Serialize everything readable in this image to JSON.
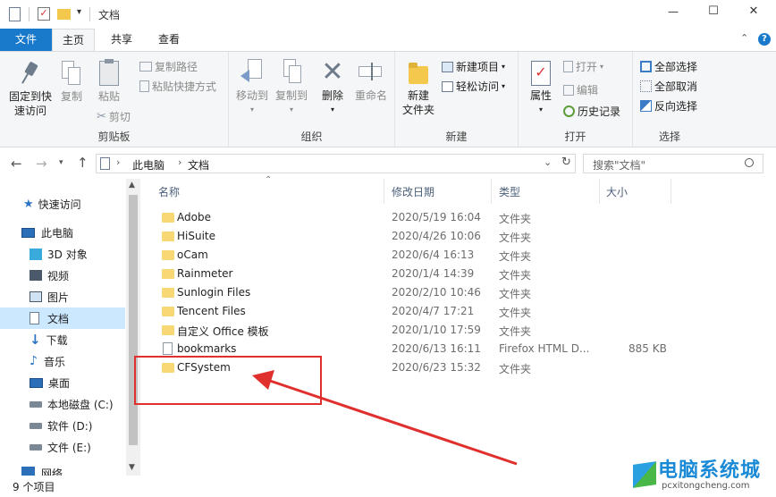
{
  "window": {
    "title": "文档",
    "minimize_glyph": "—",
    "maximize_glyph": "☐",
    "close_glyph": "✕"
  },
  "tabs": {
    "file": "文件",
    "home": "主页",
    "share": "共享",
    "view": "查看"
  },
  "ribbon": {
    "clipboard": {
      "group_label": "剪贴板",
      "pin_line1": "固定到快",
      "pin_line2": "速访问",
      "copy": "复制",
      "paste": "粘贴",
      "copy_path": "复制路径",
      "paste_shortcut": "粘贴快捷方式",
      "cut": "剪切"
    },
    "organize": {
      "group_label": "组织",
      "move_to": "移动到",
      "copy_to": "复制到",
      "delete": "删除",
      "rename": "重命名"
    },
    "new": {
      "group_label": "新建",
      "new_folder_line1": "新建",
      "new_folder_line2": "文件夹",
      "new_item": "新建项目",
      "easy_access": "轻松访问"
    },
    "open": {
      "group_label": "打开",
      "properties": "属性",
      "open": "打开",
      "edit": "编辑",
      "history": "历史记录"
    },
    "select": {
      "group_label": "选择",
      "select_all": "全部选择",
      "select_none": "全部取消",
      "invert": "反向选择"
    }
  },
  "address": {
    "path": [
      "此电脑",
      "文档"
    ],
    "search_placeholder": "搜索\"文档\""
  },
  "nav": {
    "items": [
      {
        "label": "快速访问",
        "icon": "star-icon"
      },
      {
        "label": "此电脑",
        "icon": "computer-icon"
      },
      {
        "label": "3D 对象",
        "icon": "cube-icon"
      },
      {
        "label": "视频",
        "icon": "video-icon"
      },
      {
        "label": "图片",
        "icon": "picture-icon"
      },
      {
        "label": "文档",
        "icon": "document-icon"
      },
      {
        "label": "下载",
        "icon": "download-icon"
      },
      {
        "label": "音乐",
        "icon": "music-icon"
      },
      {
        "label": "桌面",
        "icon": "desktop-icon"
      },
      {
        "label": "本地磁盘 (C:)",
        "icon": "drive-icon"
      },
      {
        "label": "软件 (D:)",
        "icon": "drive-icon"
      },
      {
        "label": "文件 (E:)",
        "icon": "drive-icon"
      },
      {
        "label": "网络",
        "icon": "network-icon"
      }
    ]
  },
  "columns": {
    "name": "名称",
    "date": "修改日期",
    "type": "类型",
    "size": "大小"
  },
  "files": [
    {
      "name": "Adobe",
      "date": "2020/5/19 16:04",
      "type": "文件夹",
      "size": ""
    },
    {
      "name": "HiSuite",
      "date": "2020/4/26 10:06",
      "type": "文件夹",
      "size": ""
    },
    {
      "name": "oCam",
      "date": "2020/6/4 16:13",
      "type": "文件夹",
      "size": ""
    },
    {
      "name": "Rainmeter",
      "date": "2020/1/4 14:39",
      "type": "文件夹",
      "size": ""
    },
    {
      "name": "Sunlogin Files",
      "date": "2020/2/10 10:46",
      "type": "文件夹",
      "size": ""
    },
    {
      "name": "Tencent Files",
      "date": "2020/4/7 17:21",
      "type": "文件夹",
      "size": ""
    },
    {
      "name": "自定义 Office 模板",
      "date": "2020/1/10 17:59",
      "type": "文件夹",
      "size": ""
    },
    {
      "name": "bookmarks",
      "date": "2020/6/13 16:11",
      "type": "Firefox HTML D...",
      "size": "885 KB"
    },
    {
      "name": "CFSystem",
      "date": "2020/6/23 15:32",
      "type": "文件夹",
      "size": ""
    }
  ],
  "status": {
    "count": "9 个项目"
  },
  "watermark": {
    "text": "电脑系统城",
    "url": "pcxitongcheng.com"
  },
  "colors": {
    "accent": "#1979ca",
    "annotation": "#e0302e",
    "selection": "#cce8ff",
    "folder": "#f8d775"
  }
}
